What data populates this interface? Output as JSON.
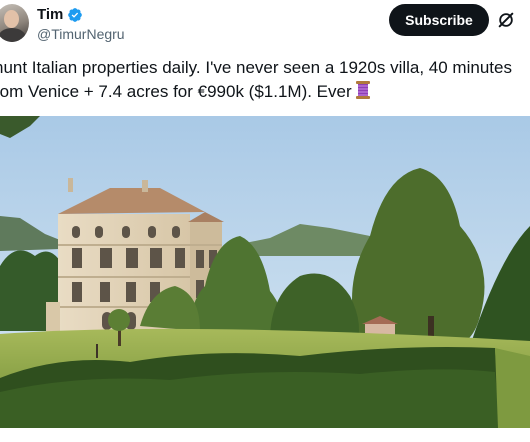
{
  "author": {
    "name": "Tim",
    "handle": "@TimurNegru",
    "verified_icon": "verified-badge-icon",
    "badge_color": "#1d9bf0"
  },
  "actions": {
    "subscribe_label": "Subscribe",
    "grok_icon": "grok-slash-icon"
  },
  "tweet": {
    "line1": "hunt Italian properties daily. I've never seen a 1920s villa, 40 minutes",
    "line2": "rom Venice + 7.4 acres for €990k ($1.1M). Ever",
    "emoji_icon": "thread-spool-icon"
  },
  "media": {
    "image_icon": "villa-photo",
    "sky_color": "#b9d6ee",
    "lawn_color": "#8aa54a"
  }
}
